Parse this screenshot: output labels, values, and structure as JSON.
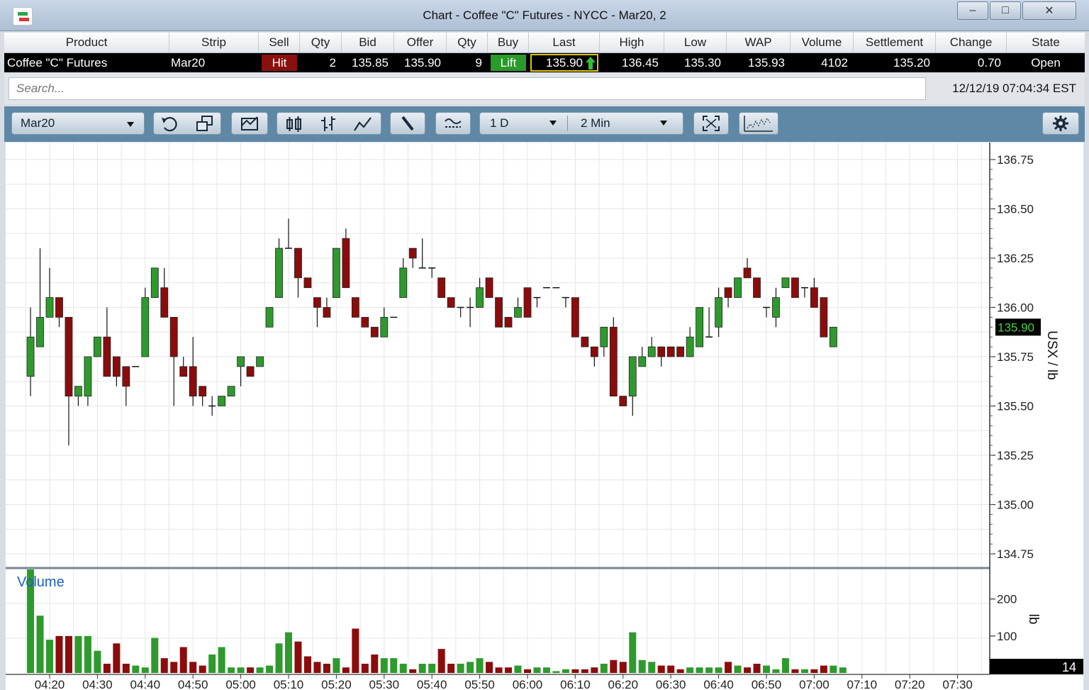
{
  "window": {
    "title": "Chart - Coffee \"C\" Futures - NYCC - Mar20, 2",
    "minimize": "–",
    "maximize": "□",
    "close": "✕"
  },
  "quote": {
    "headers": [
      "Product",
      "Strip",
      "Sell",
      "Qty",
      "Bid",
      "Offer",
      "Qty",
      "Buy",
      "Last",
      "High",
      "Low",
      "WAP",
      "Volume",
      "Settlement",
      "Change",
      "State"
    ],
    "product": "Coffee \"C\" Futures",
    "strip": "Mar20",
    "sell": "Hit",
    "bid_qty": "2",
    "bid": "135.85",
    "offer": "135.90",
    "offer_qty": "9",
    "buy": "Lift",
    "last": "135.90",
    "high": "136.45",
    "low": "135.30",
    "wap": "135.93",
    "volume": "4102",
    "settlement": "135.20",
    "change": "0.70",
    "state": "Open"
  },
  "search": {
    "placeholder": "Search...",
    "timestamp": "12/12/19 07:04:34 EST"
  },
  "toolbar": {
    "contract": "Mar20",
    "period": "1 D",
    "interval": "2 Min",
    "icons": [
      "undo-icon",
      "copy-window-icon",
      "envelope-chart-icon",
      "candlestick-icon",
      "ohlc-bar-icon",
      "line-chart-icon",
      "draw-line-icon",
      "indicator-icon",
      "expand-icon",
      "volume-profile-icon",
      "gear-icon"
    ]
  },
  "colors": {
    "up": "#2e9a2e",
    "down": "#8b0c0c",
    "grid": "#e6e6e6",
    "last_bg": "#000000",
    "last_fg": "#43d23b",
    "volume_label": "#1e5fbf"
  },
  "chart_data": {
    "type": "candlestick",
    "ylabel": "USX / lb",
    "ylim": [
      134.75,
      136.75
    ],
    "yticks": [
      "136.75",
      "136.50",
      "136.25",
      "136.00",
      "135.75",
      "135.50",
      "135.25",
      "135.00",
      "134.75"
    ],
    "last_price": "135.90",
    "x_ticks": [
      "04:20",
      "04:30",
      "04:40",
      "04:50",
      "05:00",
      "05:10",
      "05:20",
      "05:30",
      "05:40",
      "05:50",
      "06:00",
      "06:10",
      "06:20",
      "06:30",
      "06:40",
      "06:50",
      "07:00",
      "07:10",
      "07:20",
      "07:30"
    ],
    "x_start": "04:15",
    "interval_minutes": 2,
    "candles": [
      {
        "o": 135.65,
        "h": 136.0,
        "l": 135.55,
        "c": 135.85
      },
      {
        "o": 135.8,
        "h": 136.3,
        "l": 135.8,
        "c": 135.95
      },
      {
        "o": 135.95,
        "h": 136.2,
        "l": 135.95,
        "c": 136.05
      },
      {
        "o": 136.05,
        "h": 136.05,
        "l": 135.9,
        "c": 135.95
      },
      {
        "o": 135.95,
        "h": 135.95,
        "l": 135.3,
        "c": 135.55
      },
      {
        "o": 135.55,
        "h": 135.6,
        "l": 135.5,
        "c": 135.6
      },
      {
        "o": 135.55,
        "h": 135.75,
        "l": 135.5,
        "c": 135.75
      },
      {
        "o": 135.75,
        "h": 135.85,
        "l": 135.75,
        "c": 135.85
      },
      {
        "o": 135.85,
        "h": 136.0,
        "l": 135.65,
        "c": 135.65
      },
      {
        "o": 135.75,
        "h": 135.75,
        "l": 135.6,
        "c": 135.65
      },
      {
        "o": 135.7,
        "h": 135.7,
        "l": 135.5,
        "c": 135.6
      },
      {
        "o": 135.7,
        "h": 135.7,
        "l": 135.7,
        "c": 135.7
      },
      {
        "o": 135.75,
        "h": 136.1,
        "l": 135.75,
        "c": 136.05
      },
      {
        "o": 136.05,
        "h": 136.2,
        "l": 136.05,
        "c": 136.2
      },
      {
        "o": 136.1,
        "h": 136.2,
        "l": 135.95,
        "c": 135.95
      },
      {
        "o": 135.95,
        "h": 135.95,
        "l": 135.5,
        "c": 135.75
      },
      {
        "o": 135.7,
        "h": 135.75,
        "l": 135.65,
        "c": 135.65
      },
      {
        "o": 135.7,
        "h": 135.85,
        "l": 135.5,
        "c": 135.55
      },
      {
        "o": 135.6,
        "h": 135.6,
        "l": 135.5,
        "c": 135.55
      },
      {
        "o": 135.5,
        "h": 135.55,
        "l": 135.45,
        "c": 135.5
      },
      {
        "o": 135.5,
        "h": 135.55,
        "l": 135.5,
        "c": 135.55
      },
      {
        "o": 135.55,
        "h": 135.6,
        "l": 135.55,
        "c": 135.6
      },
      {
        "o": 135.7,
        "h": 135.75,
        "l": 135.6,
        "c": 135.75
      },
      {
        "o": 135.7,
        "h": 135.7,
        "l": 135.65,
        "c": 135.65
      },
      {
        "o": 135.7,
        "h": 135.75,
        "l": 135.7,
        "c": 135.75
      },
      {
        "o": 135.9,
        "h": 136.0,
        "l": 135.9,
        "c": 136.0
      },
      {
        "o": 136.05,
        "h": 136.35,
        "l": 136.05,
        "c": 136.3
      },
      {
        "o": 136.3,
        "h": 136.45,
        "l": 136.3,
        "c": 136.3
      },
      {
        "o": 136.3,
        "h": 136.3,
        "l": 136.05,
        "c": 136.15
      },
      {
        "o": 136.15,
        "h": 136.15,
        "l": 136.1,
        "c": 136.1
      },
      {
        "o": 136.05,
        "h": 136.05,
        "l": 135.9,
        "c": 136.0
      },
      {
        "o": 136.0,
        "h": 136.05,
        "l": 135.95,
        "c": 135.95
      },
      {
        "o": 136.05,
        "h": 136.3,
        "l": 136.05,
        "c": 136.3
      },
      {
        "o": 136.35,
        "h": 136.4,
        "l": 136.1,
        "c": 136.1
      },
      {
        "o": 136.05,
        "h": 136.05,
        "l": 135.95,
        "c": 135.95
      },
      {
        "o": 135.95,
        "h": 135.95,
        "l": 135.9,
        "c": 135.9
      },
      {
        "o": 135.9,
        "h": 135.85,
        "l": 135.85,
        "c": 135.85
      },
      {
        "o": 135.85,
        "h": 136.0,
        "l": 135.85,
        "c": 135.95
      },
      {
        "o": 135.95,
        "h": 135.95,
        "l": 135.95,
        "c": 135.95
      },
      {
        "o": 136.05,
        "h": 136.25,
        "l": 136.05,
        "c": 136.2
      },
      {
        "o": 136.3,
        "h": 136.3,
        "l": 136.2,
        "c": 136.25
      },
      {
        "o": 136.2,
        "h": 136.35,
        "l": 136.2,
        "c": 136.2
      },
      {
        "o": 136.2,
        "h": 136.2,
        "l": 136.15,
        "c": 136.2
      },
      {
        "o": 136.15,
        "h": 136.15,
        "l": 136.05,
        "c": 136.05
      },
      {
        "o": 136.05,
        "h": 136.05,
        "l": 136.0,
        "c": 136.0
      },
      {
        "o": 136.0,
        "h": 136.0,
        "l": 135.95,
        "c": 136.0
      },
      {
        "o": 136.0,
        "h": 136.05,
        "l": 135.9,
        "c": 136.0
      },
      {
        "o": 136.0,
        "h": 136.15,
        "l": 136.0,
        "c": 136.1
      },
      {
        "o": 136.15,
        "h": 136.15,
        "l": 136.05,
        "c": 136.05
      },
      {
        "o": 136.05,
        "h": 136.05,
        "l": 135.9,
        "c": 135.9
      },
      {
        "o": 135.95,
        "h": 135.95,
        "l": 135.9,
        "c": 135.9
      },
      {
        "o": 135.95,
        "h": 136.05,
        "l": 135.95,
        "c": 136.0
      },
      {
        "o": 136.1,
        "h": 136.1,
        "l": 135.95,
        "c": 135.95
      },
      {
        "o": 136.05,
        "h": 136.05,
        "l": 136.0,
        "c": 136.05
      },
      {
        "o": 136.1,
        "h": 136.1,
        "l": 136.1,
        "c": 136.1
      },
      {
        "o": 136.1,
        "h": 136.1,
        "l": 136.1,
        "c": 136.1
      },
      {
        "o": 136.05,
        "h": 136.05,
        "l": 136.0,
        "c": 136.05
      },
      {
        "o": 136.05,
        "h": 136.05,
        "l": 135.85,
        "c": 135.85
      },
      {
        "o": 135.85,
        "h": 135.85,
        "l": 135.8,
        "c": 135.8
      },
      {
        "o": 135.8,
        "h": 135.8,
        "l": 135.7,
        "c": 135.75
      },
      {
        "o": 135.8,
        "h": 135.9,
        "l": 135.75,
        "c": 135.9
      },
      {
        "o": 135.9,
        "h": 135.95,
        "l": 135.55,
        "c": 135.55
      },
      {
        "o": 135.55,
        "h": 135.55,
        "l": 135.5,
        "c": 135.5
      },
      {
        "o": 135.55,
        "h": 135.75,
        "l": 135.45,
        "c": 135.75
      },
      {
        "o": 135.7,
        "h": 135.8,
        "l": 135.7,
        "c": 135.75
      },
      {
        "o": 135.75,
        "h": 135.85,
        "l": 135.75,
        "c": 135.8
      },
      {
        "o": 135.8,
        "h": 135.8,
        "l": 135.7,
        "c": 135.75
      },
      {
        "o": 135.8,
        "h": 135.8,
        "l": 135.75,
        "c": 135.75
      },
      {
        "o": 135.8,
        "h": 135.8,
        "l": 135.75,
        "c": 135.75
      },
      {
        "o": 135.75,
        "h": 135.9,
        "l": 135.75,
        "c": 135.85
      },
      {
        "o": 135.8,
        "h": 136.0,
        "l": 135.8,
        "c": 136.0
      },
      {
        "o": 135.85,
        "h": 136.0,
        "l": 135.85,
        "c": 135.85
      },
      {
        "o": 135.9,
        "h": 136.1,
        "l": 135.85,
        "c": 136.05
      },
      {
        "o": 136.1,
        "h": 136.1,
        "l": 136.0,
        "c": 136.05
      },
      {
        "o": 136.05,
        "h": 136.15,
        "l": 136.05,
        "c": 136.15
      },
      {
        "o": 136.2,
        "h": 136.25,
        "l": 136.15,
        "c": 136.15
      },
      {
        "o": 136.15,
        "h": 136.15,
        "l": 136.05,
        "c": 136.05
      },
      {
        "o": 136.0,
        "h": 136.0,
        "l": 135.95,
        "c": 136.0
      },
      {
        "o": 135.95,
        "h": 136.1,
        "l": 135.9,
        "c": 136.05
      },
      {
        "o": 136.1,
        "h": 136.15,
        "l": 136.1,
        "c": 136.15
      },
      {
        "o": 136.15,
        "h": 136.15,
        "l": 136.05,
        "c": 136.05
      },
      {
        "o": 136.1,
        "h": 136.1,
        "l": 136.05,
        "c": 136.1
      },
      {
        "o": 136.1,
        "h": 136.15,
        "l": 136.0,
        "c": 136.0
      },
      {
        "o": 136.05,
        "h": 136.05,
        "l": 135.85,
        "c": 135.85
      },
      {
        "o": 135.8,
        "h": 135.9,
        "l": 135.8,
        "c": 135.9
      }
    ],
    "volume": {
      "label": "Volume",
      "ylabel": "lb",
      "ylim": [
        0,
        280
      ],
      "yticks": [
        "200",
        "100"
      ],
      "last_value": "14",
      "values": [
        280,
        155,
        90,
        100,
        100,
        100,
        100,
        60,
        25,
        80,
        25,
        20,
        15,
        95,
        40,
        30,
        70,
        30,
        20,
        50,
        70,
        15,
        15,
        15,
        15,
        20,
        80,
        110,
        85,
        45,
        30,
        25,
        40,
        15,
        120,
        25,
        50,
        40,
        40,
        25,
        10,
        25,
        25,
        65,
        25,
        25,
        30,
        40,
        30,
        15,
        15,
        20,
        10,
        15,
        15,
        5,
        10,
        10,
        10,
        15,
        25,
        35,
        30,
        110,
        35,
        30,
        20,
        20,
        10,
        15,
        15,
        15,
        15,
        30,
        20,
        15,
        25,
        20,
        10,
        40,
        10,
        10,
        10,
        20,
        20,
        15
      ]
    }
  }
}
